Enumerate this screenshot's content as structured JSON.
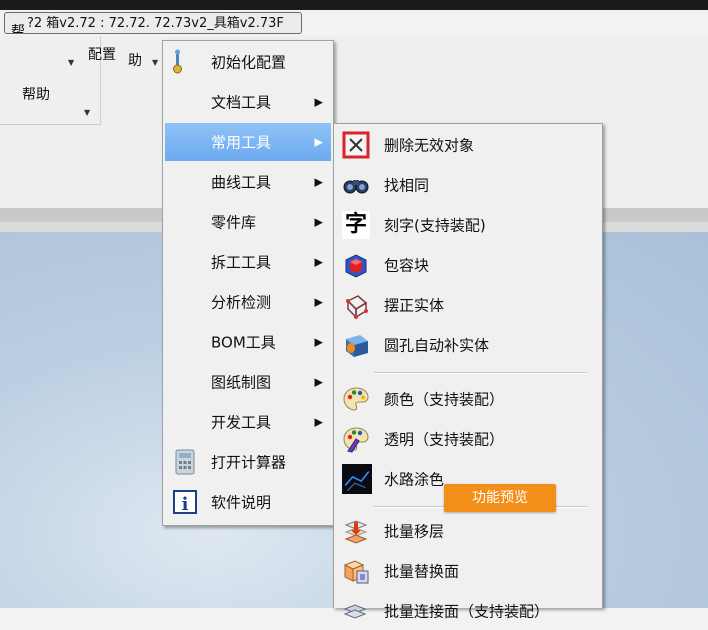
{
  "window": {
    "title_prefix": "帮",
    "title_text": "?2 箱v2.72 : 72.72. 72.73v2_具箱v2.73F"
  },
  "ribbon": {
    "help_label": "帮助",
    "config_label": "配置",
    "help_short_label": "助",
    "tool_short_label": "箱"
  },
  "menu_main": {
    "items": [
      {
        "label": "初始化配置",
        "icon": "settings-gear-icon",
        "submenu": false
      },
      {
        "label": "文档工具",
        "icon": "",
        "submenu": true
      },
      {
        "label": "常用工具",
        "icon": "",
        "submenu": true,
        "active": true
      },
      {
        "label": "曲线工具",
        "icon": "",
        "submenu": true
      },
      {
        "label": "零件库",
        "icon": "",
        "submenu": true
      },
      {
        "label": "拆工工具",
        "icon": "",
        "submenu": true
      },
      {
        "label": "分析检测",
        "icon": "",
        "submenu": true
      },
      {
        "label": "BOM工具",
        "icon": "",
        "submenu": true
      },
      {
        "label": "图纸制图",
        "icon": "",
        "submenu": true
      },
      {
        "label": "开发工具",
        "icon": "",
        "submenu": true
      },
      {
        "label": "打开计算器",
        "icon": "calculator-icon",
        "submenu": false
      },
      {
        "label": "软件说明",
        "icon": "info-icon",
        "submenu": false
      }
    ]
  },
  "menu_sub": {
    "items": [
      {
        "label": "删除无效对象",
        "icon": "delete-invalid-icon"
      },
      {
        "label": "找相同",
        "icon": "binoculars-icon"
      },
      {
        "label": "刻字(支持装配)",
        "icon": "engrave-text-icon",
        "glyph": "字"
      },
      {
        "label": "包容块",
        "icon": "bounding-box-icon"
      },
      {
        "label": "摆正实体",
        "icon": "align-solid-icon"
      },
      {
        "label": "圆孔自动补实体",
        "icon": "fill-hole-icon"
      },
      {
        "label": "颜色（支持装配）",
        "icon": "color-palette-icon"
      },
      {
        "label": "透明（支持装配）",
        "icon": "transparency-palette-icon"
      },
      {
        "label": "水路涂色",
        "icon": "waterline-color-icon"
      },
      {
        "label": "批量移层",
        "icon": "batch-move-layer-icon"
      },
      {
        "label": "批量替换面",
        "icon": "batch-replace-face-icon"
      },
      {
        "label": "批量连接面（支持装配）",
        "icon": "batch-connect-face-icon"
      }
    ]
  },
  "preview_button": {
    "label": "功能预览"
  },
  "colors": {
    "accent": "#6ba9ee",
    "preview_orange": "#f28f18"
  }
}
